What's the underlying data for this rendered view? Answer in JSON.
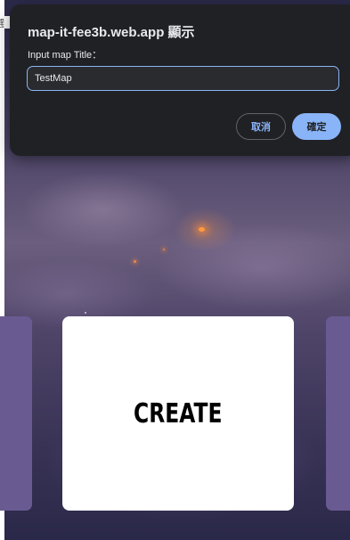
{
  "dialog": {
    "title": "map-it-fee3b.web.app 顯示",
    "message": "Input map Title：",
    "input_value": "TestMap",
    "cancel_label": "取消",
    "ok_label": "確定"
  },
  "main": {
    "create_card_label": "CREATE"
  },
  "edge": {
    "clipped_glyph": "選"
  },
  "colors": {
    "dialog_bg": "#202124",
    "accent": "#8ab4f8",
    "side_card": "#6a5a92",
    "card": "#ffffff"
  }
}
